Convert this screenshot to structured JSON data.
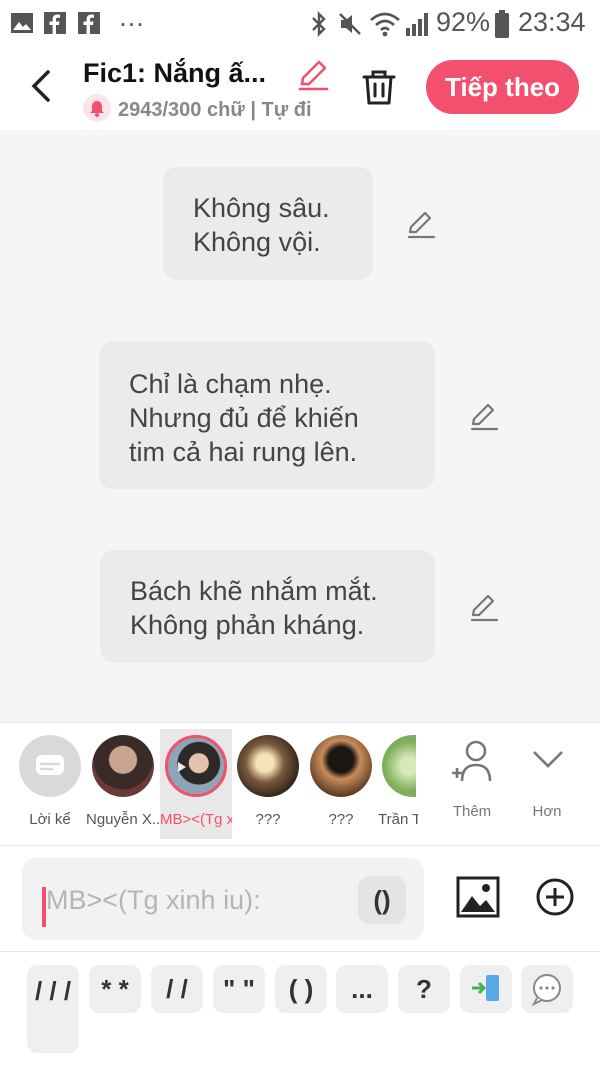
{
  "status_bar": {
    "battery": "92%",
    "time": "23:34",
    "dots": "…"
  },
  "header": {
    "title": "Fic1: Nắng ấ...",
    "subtitle": "2943/300 chữ | Tự đi",
    "next_label": "Tiếp theo"
  },
  "messages": [
    {
      "lines": [
        "Không sâu.",
        "Không vội."
      ]
    },
    {
      "lines": [
        "Chỉ là chạm nhẹ.",
        "Nhưng đủ để khiến",
        "tim cả hai rung lên."
      ]
    },
    {
      "lines": [
        "Bách khẽ nhắm mắt.",
        "Không phản kháng."
      ]
    }
  ],
  "characters": [
    {
      "label": "Lời kể",
      "selected": false
    },
    {
      "label": "Nguyễn X...",
      "selected": false
    },
    {
      "label": "MB><(Tg x...",
      "selected": true
    },
    {
      "label": "???",
      "selected": false
    },
    {
      "label": "???",
      "selected": false
    },
    {
      "label": "Trần T",
      "selected": false
    }
  ],
  "character_actions": {
    "add_label": "Thêm",
    "more_label": "Hơn"
  },
  "input": {
    "placeholder": "MB><(Tg xinh iu):",
    "paren_label": "()"
  },
  "symbols": [
    "/ / /",
    "* *",
    "/ /",
    "\" \"",
    "( )",
    "...",
    "?"
  ],
  "colors": {
    "accent": "#f2506e",
    "bubble": "#ebebeb",
    "background": "#f5f5f5"
  }
}
